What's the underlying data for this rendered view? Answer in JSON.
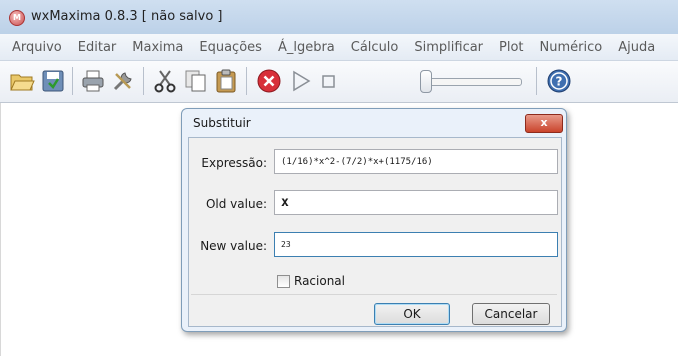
{
  "window": {
    "title": "wxMaxima 0.8.3 [ não salvo ]"
  },
  "menu": [
    "Arquivo",
    "Editar",
    "Maxima",
    "Equações",
    "Á_lgebra",
    "Cálculo",
    "Simplificar",
    "Plot",
    "Numérico",
    "Ajuda"
  ],
  "toolbar": {
    "icons": [
      "open-folder",
      "save",
      "print",
      "preferences",
      "cut",
      "copy",
      "paste",
      "stop",
      "play",
      "stop-square",
      "slider",
      "help"
    ]
  },
  "dialog": {
    "title": "Substituir",
    "close_label": "x",
    "fields": {
      "expression_label": "Expressão:",
      "expression_value": "(1/16)*x^2-(7/2)*x+(1175/16)",
      "old_label": "Old value:",
      "old_value": "x",
      "new_label": "New value:",
      "new_value": "23"
    },
    "checkbox_label": "Racional",
    "ok_label": "OK",
    "cancel_label": "Cancelar"
  },
  "colors": {
    "titlebar": "#bcd1e8",
    "dialog_frame": "#eaf1fa",
    "close_button": "#c9442c",
    "focus_border": "#3c7fb1"
  }
}
